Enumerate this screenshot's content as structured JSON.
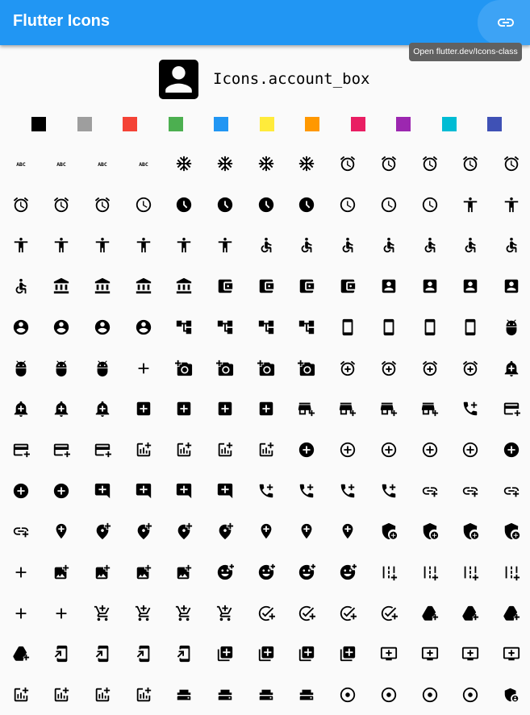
{
  "app_title": "Flutter Icons",
  "tooltip": "Open flutter.dev/Icons-class",
  "preview": {
    "icon": "account-box-icon",
    "name": "Icons.account_box"
  },
  "colors": [
    "#000000",
    "#9e9e9e",
    "#f44336",
    "#4caf50",
    "#2196f3",
    "#ffeb3b",
    "#ff9800",
    "#e91e63",
    "#9c27b0",
    "#00bcd4",
    "#3f51b5"
  ],
  "color_names": [
    "black",
    "grey",
    "red",
    "green",
    "blue",
    "yellow",
    "orange",
    "pink",
    "purple",
    "cyan",
    "indigo"
  ],
  "icon_grid": [
    [
      "abc-icon",
      "abc-icon",
      "abc-icon",
      "abc-icon",
      "ac-unit-icon",
      "ac-unit-icon",
      "ac-unit-icon",
      "ac-unit-icon",
      "access-alarm-icon",
      "access-alarm-icon",
      "access-alarm-icon",
      "access-alarm-icon",
      "access-alarm-icon"
    ],
    [
      "access-alarm-icon",
      "access-alarm-icon",
      "access-alarm-icon",
      "access-time-icon",
      "access-time-filled-icon",
      "access-time-filled-icon",
      "access-time-filled-icon",
      "access-time-filled-icon",
      "access-time-icon",
      "access-time-icon",
      "access-time-icon",
      "accessibility-icon",
      "accessibility-icon"
    ],
    [
      "accessibility-icon",
      "accessibility-icon",
      "accessibility-icon",
      "accessibility-icon",
      "accessibility-icon",
      "accessibility-icon",
      "accessible-icon",
      "accessible-forward-icon",
      "accessible-forward-icon",
      "accessible-forward-icon",
      "accessible-forward-icon",
      "accessible-forward-icon",
      "accessible-icon"
    ],
    [
      "accessible-icon",
      "account-balance-icon",
      "account-balance-icon",
      "account-balance-icon",
      "account-balance-icon",
      "account-balance-wallet-icon",
      "account-balance-wallet-icon",
      "account-balance-wallet-icon",
      "account-balance-wallet-icon",
      "account-box-icon",
      "account-box-icon",
      "account-box-icon",
      "account-box-icon"
    ],
    [
      "account-circle-icon",
      "account-circle-icon",
      "account-circle-icon",
      "account-circle-icon",
      "account-tree-icon",
      "account-tree-icon",
      "account-tree-icon",
      "account-tree-icon",
      "ad-units-icon",
      "ad-units-icon",
      "ad-units-icon",
      "ad-units-icon",
      "adb-icon"
    ],
    [
      "adb-icon",
      "adb-icon",
      "adb-icon",
      "add-icon",
      "add-a-photo-icon",
      "add-a-photo-icon",
      "add-a-photo-icon",
      "add-a-photo-icon",
      "add-alarm-icon",
      "add-alarm-icon",
      "add-alarm-icon",
      "add-alarm-icon",
      "add-alert-icon"
    ],
    [
      "add-alert-icon",
      "add-alert-icon",
      "add-alert-icon",
      "add-box-icon",
      "add-box-icon",
      "add-box-icon",
      "add-box-icon",
      "add-business-icon",
      "add-business-icon",
      "add-business-icon",
      "add-business-icon",
      "add-call-icon",
      "add-card-icon"
    ],
    [
      "add-card-icon",
      "add-card-icon",
      "add-card-icon",
      "add-chart-icon",
      "add-chart-icon",
      "add-chart-icon",
      "add-chart-icon",
      "add-circle-icon",
      "add-circle-icon",
      "add-circle-icon",
      "add-circle-icon",
      "add-circle-icon",
      "add-circle-icon"
    ],
    [
      "add-circle-icon",
      "add-circle-icon",
      "add-comment-icon",
      "add-comment-icon",
      "add-comment-icon",
      "add-comment-icon",
      "add-ic-call-icon",
      "add-ic-call-icon",
      "add-ic-call-icon",
      "add-ic-call-icon",
      "add-link-icon",
      "add-link-icon",
      "add-link-icon"
    ],
    [
      "add-link-icon",
      "add-location-icon",
      "add-location-alt-icon",
      "add-location-alt-icon",
      "add-location-alt-icon",
      "add-location-alt-icon",
      "add-location-icon",
      "add-location-icon",
      "add-location-icon",
      "add-moderator-icon",
      "add-moderator-icon",
      "add-moderator-icon",
      "add-moderator-icon"
    ],
    [
      "add-icon",
      "add-photo-alternate-icon",
      "add-photo-alternate-icon",
      "add-photo-alternate-icon",
      "add-photo-alternate-icon",
      "add-reaction-icon",
      "add-reaction-icon",
      "add-reaction-icon",
      "add-reaction-icon",
      "add-road-icon",
      "add-road-icon",
      "add-road-icon",
      "add-road-icon"
    ],
    [
      "add-icon",
      "add-icon",
      "add-shopping-cart-icon",
      "add-shopping-cart-icon",
      "add-shopping-cart-icon",
      "add-shopping-cart-icon",
      "add-task-icon",
      "add-task-icon",
      "add-task-icon",
      "add-task-icon",
      "add-to-drive-icon",
      "add-to-drive-icon",
      "add-to-drive-icon"
    ],
    [
      "add-to-drive-icon",
      "add-to-home-screen-icon",
      "add-to-home-screen-icon",
      "add-to-home-screen-icon",
      "add-to-home-screen-icon",
      "add-to-photos-icon",
      "add-to-photos-icon",
      "add-to-photos-icon",
      "add-to-photos-icon",
      "add-to-queue-icon",
      "add-to-queue-icon",
      "add-to-queue-icon",
      "add-to-queue-icon"
    ],
    [
      "addchart-icon",
      "addchart-icon",
      "addchart-icon",
      "addchart-icon",
      "adf-scanner-icon",
      "adf-scanner-icon",
      "adf-scanner-icon",
      "adf-scanner-icon",
      "adjust-icon",
      "adjust-icon",
      "adjust-icon",
      "adjust-icon",
      "admin-panel-settings-icon"
    ]
  ]
}
